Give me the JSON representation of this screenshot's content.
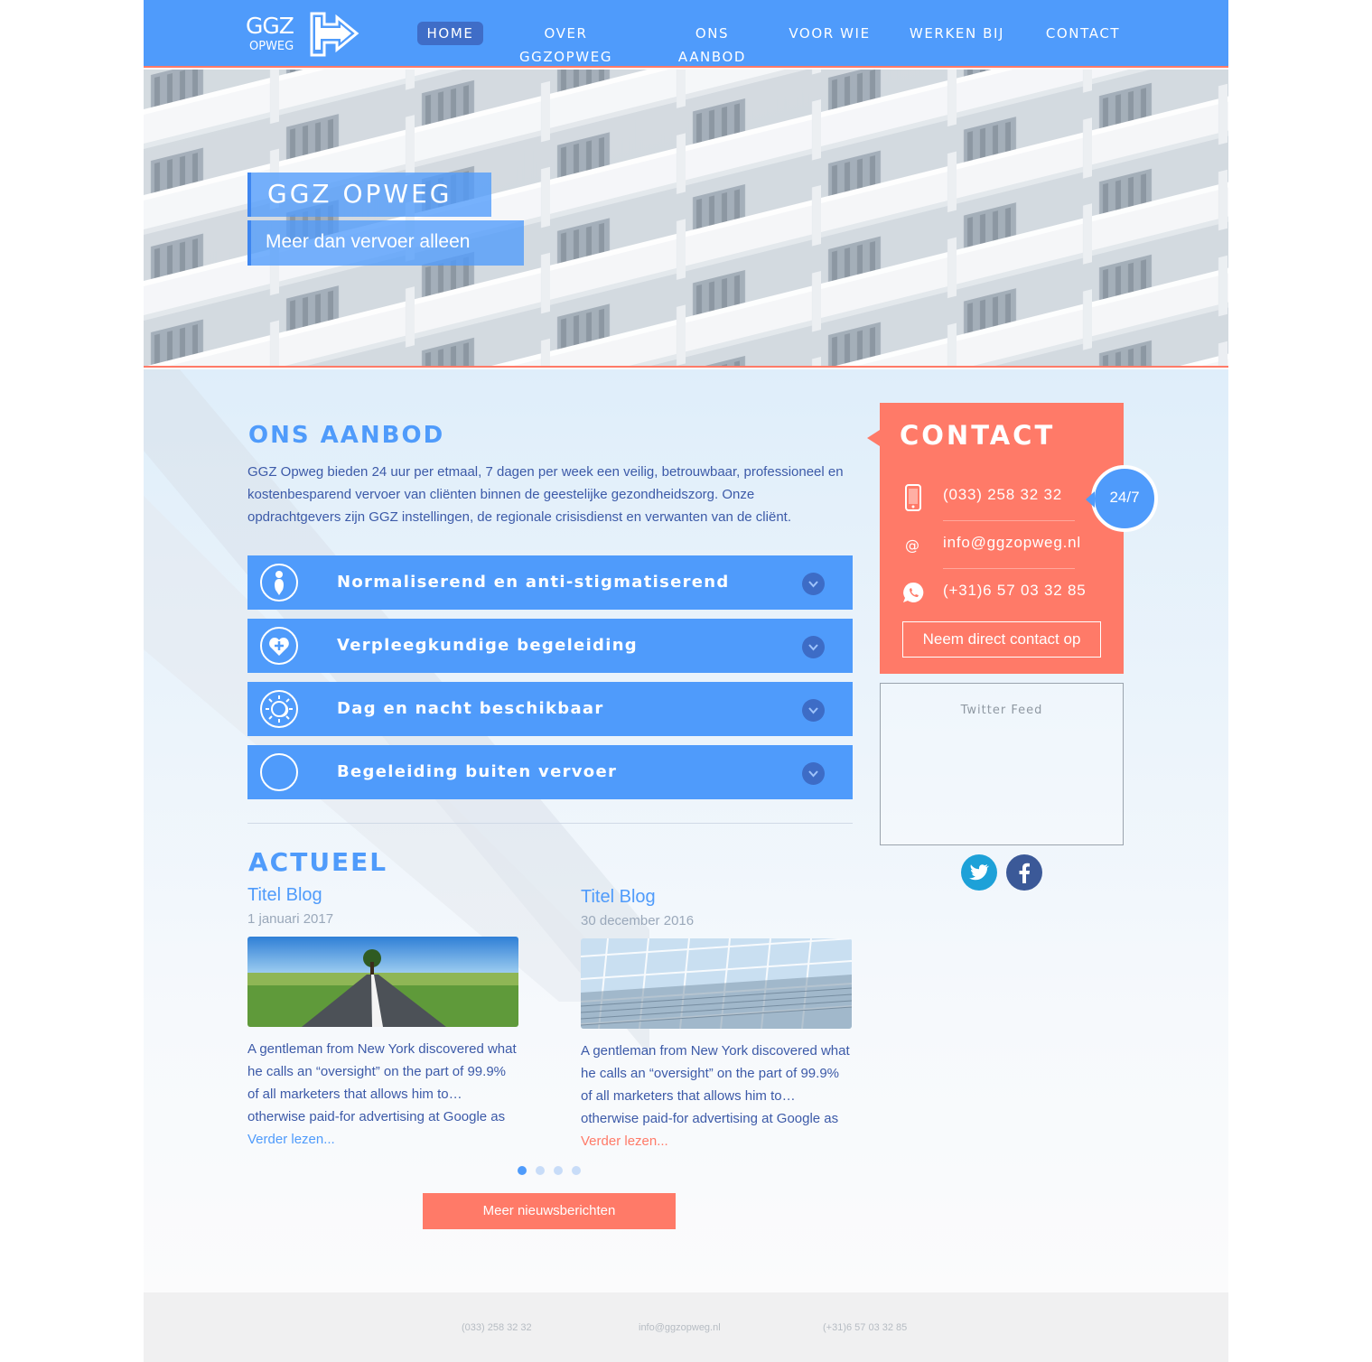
{
  "nav": {
    "logo": {
      "line1": "GGZ",
      "line2": "OPWEG"
    },
    "items": [
      {
        "label": "HOME",
        "active": true
      },
      {
        "label": "OVER GGZOPWEG",
        "active": false
      },
      {
        "label": "ONS AANBOD",
        "active": false
      },
      {
        "label": "VOOR WIE",
        "active": false
      },
      {
        "label": "WERKEN BIJ",
        "active": false
      },
      {
        "label": "CONTACT",
        "active": false
      }
    ]
  },
  "hero": {
    "title": "GGZ OPWEG",
    "subtitle": "Meer dan vervoer alleen"
  },
  "aanbod": {
    "heading": "ONS AANBOD",
    "intro": "GGZ Opweg bieden 24 uur per etmaal, 7 dagen per week een veilig, betrouwbaar, professioneel en kostenbesparend vervoer van cliënten binnen de geestelijke gezondheidszorg. Onze opdrachtgevers zijn GGZ instellingen, de regionale crisisdienst en verwanten van de cliënt.",
    "items": [
      {
        "label": "Normaliserend en anti-stigmatiserend",
        "icon": "person-icon"
      },
      {
        "label": "Verpleegkundige begeleiding",
        "icon": "heart-plus-icon"
      },
      {
        "label": "Dag en nacht beschikbaar",
        "icon": "sun-moon-icon"
      },
      {
        "label": "Begeleiding buiten vervoer",
        "icon": "circle-icon"
      }
    ]
  },
  "actueel": {
    "heading": "ACTUEEL",
    "posts": [
      {
        "title": "Titel Blog",
        "date": "1 januari 2017",
        "image": "road-landscape",
        "text": "A gentleman from New York discovered what he calls an “oversight” on the part of 99.9% of all marketers that allows him to… otherwise paid-for advertising at Google as",
        "more": "Verder lezen...",
        "more_color": "#4f9bfb"
      },
      {
        "title": "Titel Blog",
        "date": "30 december 2016",
        "image": "glass-facade",
        "text": "A gentleman from New York discovered what he calls an “oversight” on the part of 99.9% of all marketers that allows him to… otherwise paid-for advertising at Google as",
        "more": "Verder lezen...",
        "more_color": "#ff7a68"
      }
    ],
    "pager": {
      "count": 4,
      "active": 1
    },
    "more_button": "Meer nieuwsberichten"
  },
  "contact": {
    "title": "CONTACT",
    "badge": "24/7",
    "phone": "(033) 258 32 32",
    "email": "info@ggzopweg.nl",
    "whatsapp": "(+31)6 57 03 32 85",
    "button": "Neem direct contact op"
  },
  "twitter": {
    "label": "Twitter Feed"
  },
  "social": [
    {
      "name": "twitter-icon",
      "color": "#1da1d8"
    },
    {
      "name": "facebook-icon",
      "color": "#3b5998"
    }
  ],
  "footer": {
    "phone": "(033) 258 32 32",
    "email": "info@ggzopweg.nl",
    "whatsapp": "(+31)6 57 03 32 85"
  },
  "colors": {
    "primary": "#4f9bfb",
    "primary_dark": "#3f6dc7",
    "accent": "#ff7a68",
    "text": "#3c5aa8"
  }
}
